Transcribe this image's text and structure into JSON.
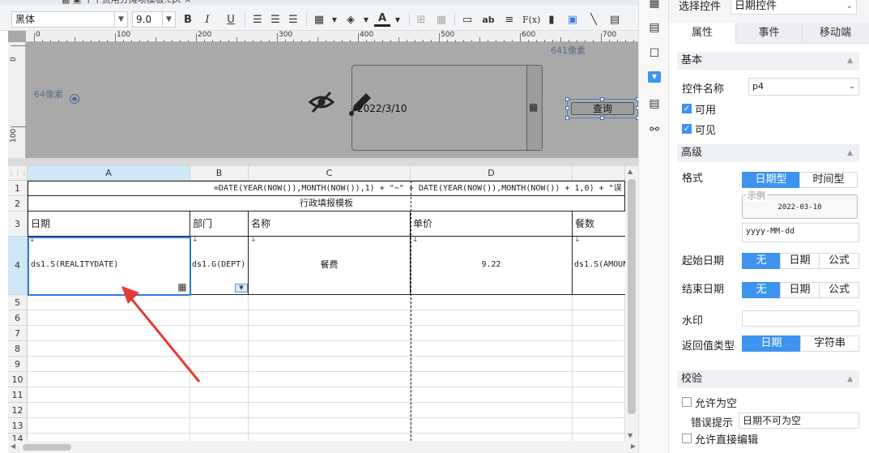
{
  "toolbar": {
    "font_family": "黑体",
    "font_size": "9.0",
    "icons": [
      "bold-icon",
      "italic-icon",
      "underline-icon",
      "align-left-icon",
      "align-center-icon",
      "align-right-icon",
      "border-icon",
      "fill-color-icon",
      "font-color-icon",
      "merge-icon",
      "grid-icon",
      "insert-row-icon",
      "text-icon",
      "align-icon",
      "formula-icon",
      "chart-icon",
      "image-icon",
      "slash-icon",
      "paste-icon"
    ]
  },
  "ruler": {
    "h_ticks": [
      "0",
      "100",
      "200",
      "300",
      "400",
      "500",
      "600",
      "700"
    ],
    "v_ticks": [
      "0",
      "100"
    ]
  },
  "design": {
    "pixel_label_top": "641像素",
    "pixel_label_left": "64像素",
    "date_value": "2022/3/10",
    "query_label": "查询"
  },
  "sheet": {
    "columns": [
      "A",
      "B",
      "C",
      "D"
    ],
    "rows": [
      "1",
      "2",
      "3",
      "4",
      "5",
      "6",
      "7",
      "8",
      "9",
      "10",
      "11",
      "12",
      "13",
      "14"
    ],
    "formula_row1": "=DATE(YEAR(NOW()),MONTH(NOW()),1) + \"~\" + DATE(YEAR(NOW()),MONTH(NOW()) + 1,0) + \"误",
    "title_row2": "行政填报模板",
    "headers_row3": [
      "日期",
      "部门",
      "名称",
      "单价",
      "餐数"
    ],
    "data_row4": [
      "ds1.S(REALITYDATE)",
      "ds1.G(DEPT)",
      "餐费",
      "9.22",
      "ds1.S(AMOUN"
    ]
  },
  "panel": {
    "select_label": "选择控件",
    "select_value": "日期控件",
    "tabs": [
      "属性",
      "事件",
      "移动端"
    ],
    "section_basic": "基本",
    "control_name_label": "控件名称",
    "control_name_value": "p4",
    "enabled_label": "可用",
    "visible_label": "可见",
    "section_advanced": "高级",
    "format_label": "格式",
    "format_options": [
      "日期型",
      "时间型"
    ],
    "example_label": "示例",
    "example_value": "2022-03-10",
    "format_pattern": "yyyy-MM-dd",
    "start_date_label": "起始日期",
    "end_date_label": "结束日期",
    "date_options": [
      "无",
      "日期",
      "公式"
    ],
    "watermark_label": "水印",
    "return_type_label": "返回值类型",
    "return_options": [
      "日期",
      "字符串"
    ],
    "section_validate": "校验",
    "allow_empty_label": "允许为空",
    "error_hint_label": "错误提示",
    "error_hint_value": "日期不可为空",
    "allow_edit_label": "允许直接编辑"
  }
}
